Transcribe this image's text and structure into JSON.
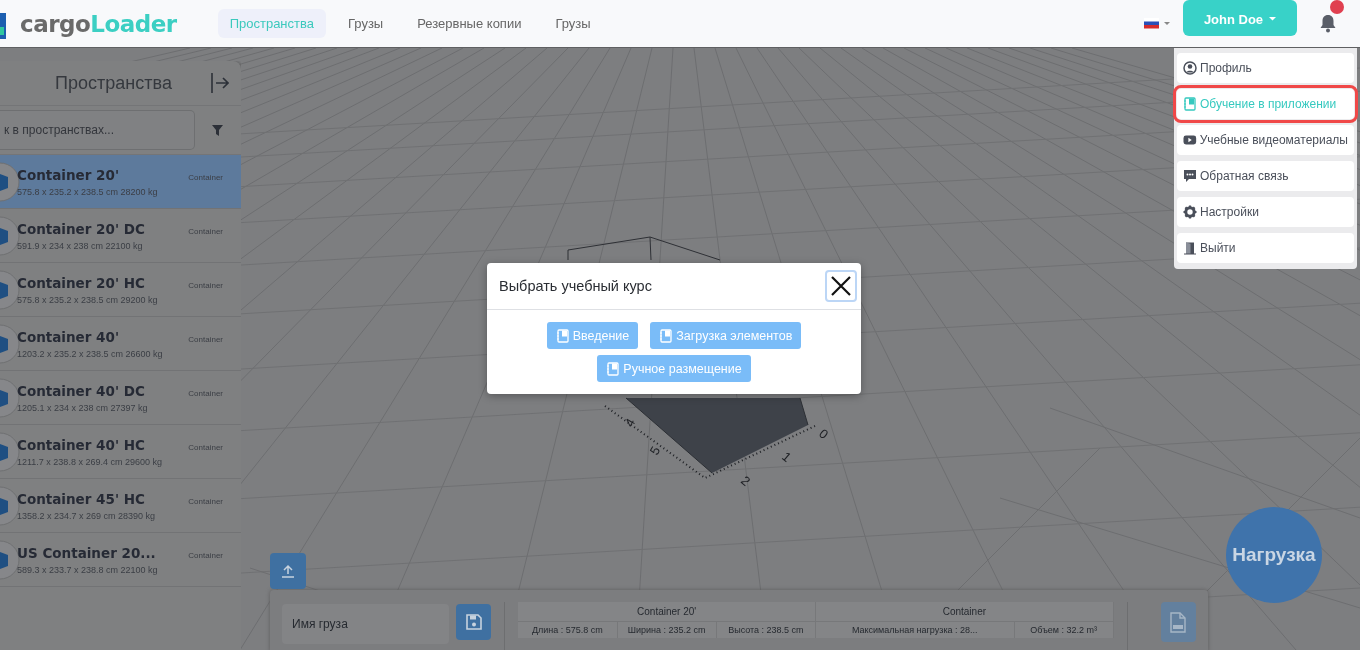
{
  "header": {
    "logo": {
      "part_1": "cargo",
      "part_2": "Loader"
    },
    "nav": [
      {
        "label": "Пространства",
        "selected": true
      },
      {
        "label": "Грузы",
        "selected": false
      },
      {
        "label": "Резервные копии",
        "selected": false
      },
      {
        "label": "Грузы",
        "selected": false
      }
    ],
    "user_button": "John Doe"
  },
  "user_menu": [
    {
      "label": "Профиль",
      "selected": false
    },
    {
      "label": "Обучение в приложении",
      "selected": true
    },
    {
      "label": "Учебные видеоматериалы",
      "selected": false
    },
    {
      "label": "Обратная связь",
      "selected": false
    },
    {
      "label": "Настройки",
      "selected": false
    },
    {
      "label": "Выйти",
      "selected": false
    }
  ],
  "sidebar": {
    "title": "Пространства",
    "search_placeholder": "к в пространствах...",
    "items": [
      {
        "name": "Container 20'",
        "dims": "575.8 x 235.2 x 238.5 cm 28200 kg",
        "type": "Container",
        "selected": true
      },
      {
        "name": "Container 20' DC",
        "dims": "591.9 x 234 x 238 cm 22100 kg",
        "type": "Container",
        "selected": false
      },
      {
        "name": "Container 20' HC",
        "dims": "575.8 x 235.2 x 238.5 cm 29200 kg",
        "type": "Container",
        "selected": false
      },
      {
        "name": "Container 40'",
        "dims": "1203.2 x 235.2 x 238.5 cm 26600 kg",
        "type": "Container",
        "selected": false
      },
      {
        "name": "Container 40' DC",
        "dims": "1205.1 x 234 x 238 cm 27397 kg",
        "type": "Container",
        "selected": false
      },
      {
        "name": "Container 40' HC",
        "dims": "1211.7 x 238.8 x 269.4 cm 29600 kg",
        "type": "Container",
        "selected": false
      },
      {
        "name": "Container 45' HC",
        "dims": "1358.2 x 234.7 x 269 cm 28390 kg",
        "type": "Container",
        "selected": false
      },
      {
        "name": "US Container 20...",
        "dims": "589.3 x 233.7 x 238.8 cm 22100 kg",
        "type": "Container",
        "selected": false
      }
    ]
  },
  "scene": {
    "axis_labels": [
      "4",
      "5",
      "2",
      "1",
      "0"
    ]
  },
  "modal": {
    "title": "Выбрать учебный курс",
    "buttons": [
      "Введение",
      "Загрузка элементов",
      "Ручное размещение"
    ]
  },
  "cargo_panel": {
    "name_placeholder": "Имя груза",
    "table_header": [
      "Container 20'",
      "Container"
    ],
    "table_row": [
      "Длина : 575.8 cm",
      "Ширина : 235.2 cm",
      "Высота : 238.5 cm",
      "Максимальная нагрузка : 28...",
      "Объем : 32.2 m³"
    ]
  },
  "load_button": "Нагрузка"
}
